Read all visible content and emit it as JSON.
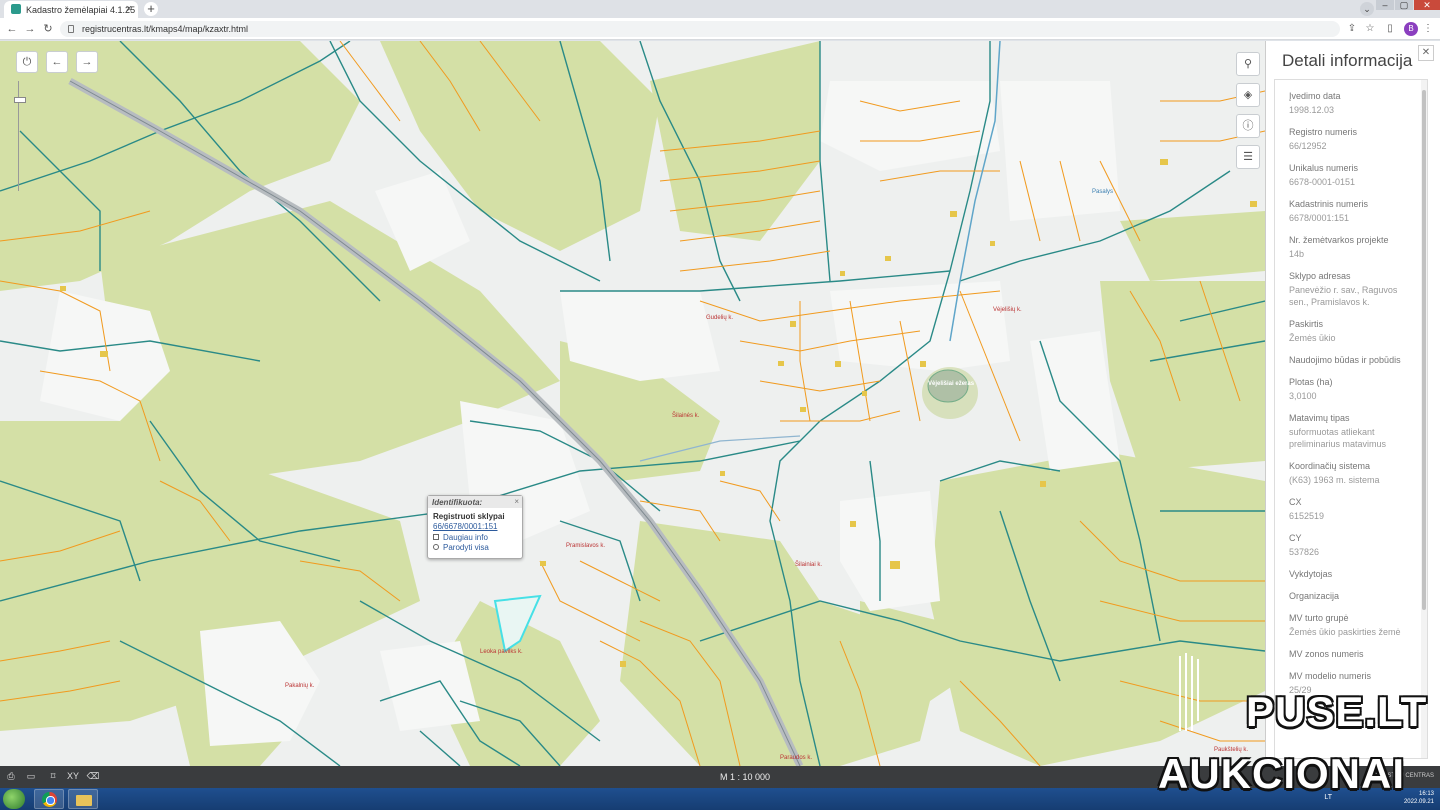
{
  "browser": {
    "tab_title": "Kadastro žemėlapiai 4.1.25",
    "tab_close": "×",
    "newtab": "+",
    "url": "registrucentras.lt/kmaps4/map/kzaxtr.html",
    "profile_initial": "B"
  },
  "map": {
    "power_button": "⏻",
    "back_button": "←",
    "forward_button": "→",
    "popup": {
      "header": "Identifikuota:",
      "close": "×",
      "title": "Registruoti sklypai",
      "parcel_link": "66/6678/0001:151",
      "more_info": "Daugiau info",
      "show_all": "Parodyti visa"
    },
    "labels": [
      "Pramislavos k.",
      "Vėjelišių k.",
      "Šilainės k.",
      "Leoka pavilks k.",
      "Gudelių k.",
      "Pakalnių k.",
      "Šilainiai k.",
      "Paukštelių k.",
      "Paraudos k.",
      "Pasalys"
    ],
    "lake_label": "Vėjelišiai ežeras",
    "side_tools": [
      "search-icon",
      "layers-icon",
      "info-icon",
      "list-icon"
    ],
    "colors": {
      "field_green": "#d4e0a6",
      "built_white": "#f4f5f4",
      "teal_line": "#2a8a87",
      "orange_line": "#f19a1e",
      "road": "#b7bcc0",
      "selection": "#46e0e6"
    }
  },
  "panel": {
    "title": "Detali informacija",
    "close": "✕",
    "fields": [
      {
        "label": "Įvedimo data",
        "value": "1998.12.03"
      },
      {
        "label": "Registro numeris",
        "value": "66/12952"
      },
      {
        "label": "Unikalus numeris",
        "value": "6678-0001-0151"
      },
      {
        "label": "Kadastrinis numeris",
        "value": "6678/0001:151"
      },
      {
        "label": "Nr. žemėtvarkos projekte",
        "value": "14b"
      },
      {
        "label": "Sklypo adresas",
        "value": "Panevėžio r. sav., Raguvos sen., Pramislavos k."
      },
      {
        "label": "Paskirtis",
        "value": "Žemės ūkio"
      },
      {
        "label": "Naudojimo būdas ir pobūdis",
        "value": ""
      },
      {
        "label": "Plotas (ha)",
        "value": "3,0100"
      },
      {
        "label": "Matavimų tipas",
        "value": "suformuotas atliekant preliminarius matavimus"
      },
      {
        "label": "Koordinačių sistema",
        "value": "(K63) 1963 m. sistema"
      },
      {
        "label": "CX",
        "value": "6152519"
      },
      {
        "label": "CY",
        "value": "537826"
      },
      {
        "label": "Vykdytojas",
        "value": ""
      },
      {
        "label": "Organizacija",
        "value": ""
      },
      {
        "label": "MV turto grupė",
        "value": "Žemės ūkio paskirties žemė"
      },
      {
        "label": "MV zonos numeris",
        "value": ""
      },
      {
        "label": "MV modelio numeris",
        "value": "25/29"
      }
    ]
  },
  "statusbar": {
    "scale": "M 1 : 10 000",
    "icons": [
      "print-icon",
      "ruler-icon",
      "bookmark-icon",
      "xy-icon",
      "eraser-icon"
    ],
    "xy_text": "XY",
    "right_text": "REGISTRŲ CENTRAS"
  },
  "taskbar": {
    "lang": "LT",
    "time": "16:13",
    "date": "2022.09.21"
  },
  "watermark": {
    "line1": "PUSE.LT",
    "line2": "AUKCIONAI"
  }
}
